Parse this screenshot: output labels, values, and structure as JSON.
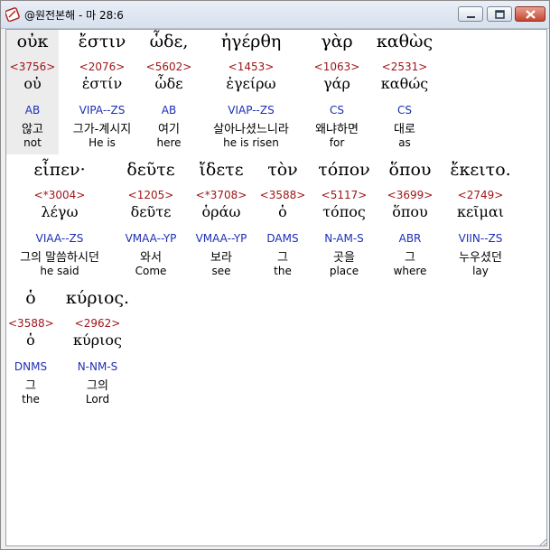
{
  "window": {
    "title": "@원전본해 - 마 28:6"
  },
  "words": [
    {
      "greek": "οὐκ",
      "strong": "<3756>",
      "lemma": "οὐ",
      "morph": "AB",
      "korean": "않고",
      "english": "not"
    },
    {
      "greek": "ἔστιν",
      "strong": "<2076>",
      "lemma": "ἐστίν",
      "morph": "VIPA--ZS",
      "korean": "그가-계시지",
      "english": "He is"
    },
    {
      "greek": "ὧδε,",
      "strong": "<5602>",
      "lemma": "ὧδε",
      "morph": "AB",
      "korean": "여기",
      "english": "here"
    },
    {
      "greek": "ἠγέρθη",
      "strong": "<1453>",
      "lemma": "ἐγείρω",
      "morph": "VIAP--ZS",
      "korean": "살아나셨느니라",
      "english": "he is risen"
    },
    {
      "greek": "γὰρ",
      "strong": "<1063>",
      "lemma": "γάρ",
      "morph": "CS",
      "korean": "왜냐하면",
      "english": "for"
    },
    {
      "greek": "καθὼς",
      "strong": "<2531>",
      "lemma": "καθώς",
      "morph": "CS",
      "korean": "대로",
      "english": "as"
    },
    {
      "greek": "εἶπεν·",
      "strong": "<*3004>",
      "lemma": "λέγω",
      "morph": "VIAA--ZS",
      "korean": "그의 말씀하시던",
      "english": "he said"
    },
    {
      "greek": "δεῦτε",
      "strong": "<1205>",
      "lemma": "δεῦτε",
      "morph": "VMAA--YP",
      "korean": "와서",
      "english": "Come"
    },
    {
      "greek": "ἴδετε",
      "strong": "<*3708>",
      "lemma": "ὁράω",
      "morph": "VMAA--YP",
      "korean": "보라",
      "english": "see"
    },
    {
      "greek": "τὸν",
      "strong": "<3588>",
      "lemma": "ὁ",
      "morph": "DAMS",
      "korean": "그",
      "english": "the"
    },
    {
      "greek": "τόπον",
      "strong": "<5117>",
      "lemma": "τόπος",
      "morph": "N-AM-S",
      "korean": "곳을",
      "english": "place"
    },
    {
      "greek": "ὅπου",
      "strong": "<3699>",
      "lemma": "ὅπου",
      "morph": "ABR",
      "korean": "그",
      "english": "where"
    },
    {
      "greek": "ἔκειτο.",
      "strong": "<2749>",
      "lemma": "κεῖμαι",
      "morph": "VIIN--ZS",
      "korean": "누우셨던",
      "english": "lay"
    },
    {
      "greek": "ὁ",
      "strong": "<3588>",
      "lemma": "ὁ",
      "morph": "DNMS",
      "korean": "그",
      "english": "the"
    },
    {
      "greek": "κύριος.",
      "strong": "<2962>",
      "lemma": "κύριος",
      "morph": "N-NM-S",
      "korean": "그의",
      "english": "Lord"
    }
  ]
}
